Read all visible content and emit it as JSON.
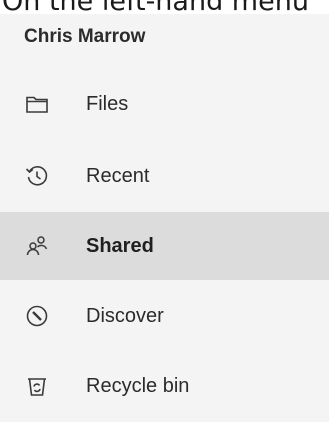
{
  "caption": "On the left-hand menu",
  "user": {
    "name": "Chris Marrow"
  },
  "nav": {
    "items": [
      {
        "label": "Files",
        "icon": "folder-icon"
      },
      {
        "label": "Recent",
        "icon": "history-icon"
      },
      {
        "label": "Shared",
        "icon": "shared-people-icon",
        "selected": true
      },
      {
        "label": "Discover",
        "icon": "compass-icon"
      },
      {
        "label": "Recycle bin",
        "icon": "recycle-bin-icon"
      }
    ]
  },
  "colors": {
    "panel_background": "#f4f4f4",
    "selected_background": "#dcdcdc",
    "text": "#2b2b2b"
  }
}
